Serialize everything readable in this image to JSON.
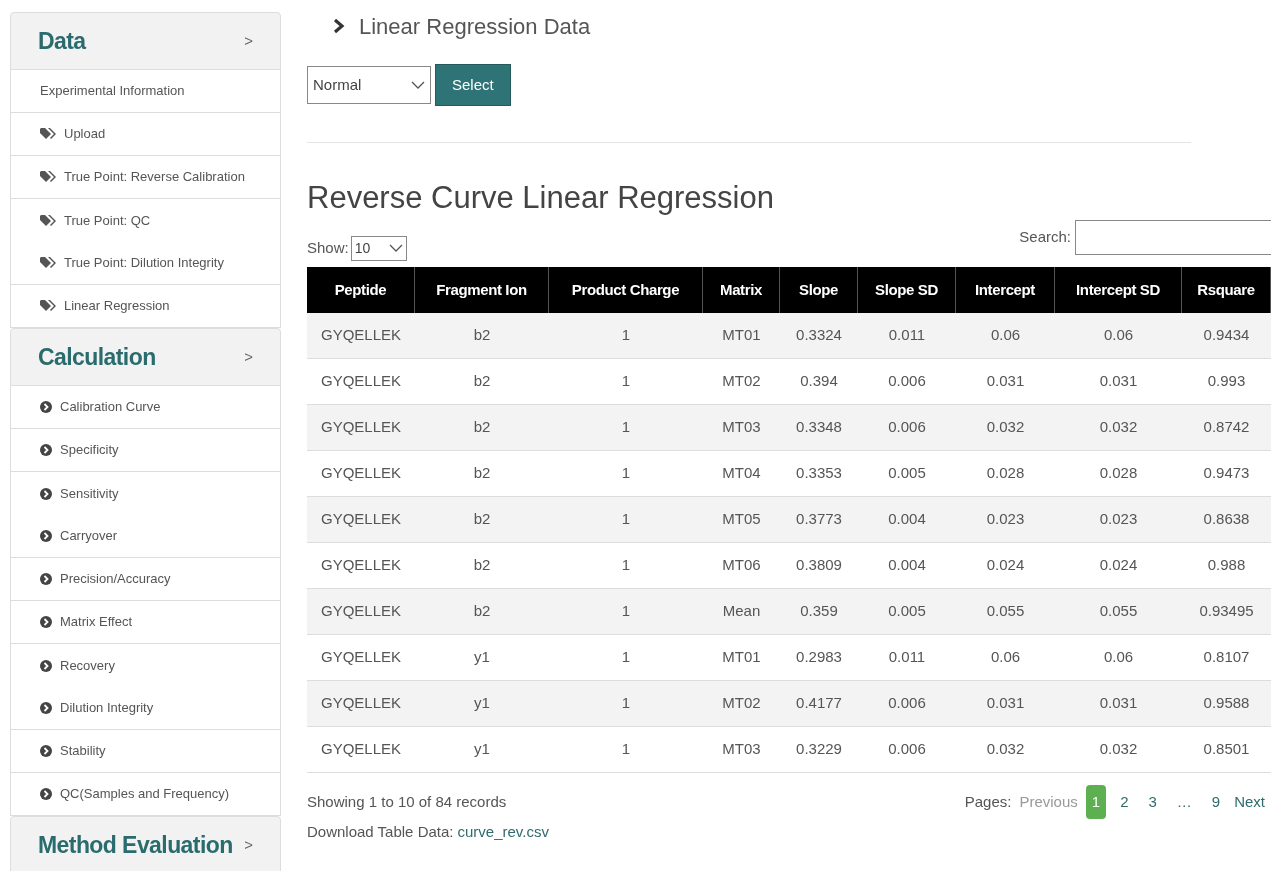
{
  "sidebar": {
    "sections": [
      {
        "title": "Data",
        "chevron": ">",
        "items": [
          {
            "label": "Experimental Information",
            "kind": "plain",
            "divider": true
          },
          {
            "label": "Upload",
            "kind": "tag",
            "divider": true
          },
          {
            "label": "True Point: Reverse Calibration",
            "kind": "tag",
            "divider": true
          },
          {
            "label": "True Point: QC",
            "kind": "tag",
            "divider": false
          },
          {
            "label": "True Point: Dilution Integrity",
            "kind": "tag",
            "divider": true
          },
          {
            "label": "Linear Regression",
            "kind": "tag",
            "divider": true
          }
        ]
      },
      {
        "title": "Calculation",
        "chevron": ">",
        "items": [
          {
            "label": "Calibration Curve",
            "kind": "circle",
            "divider": true
          },
          {
            "label": "Specificity",
            "kind": "circle",
            "divider": true
          },
          {
            "label": "Sensitivity",
            "kind": "circle",
            "divider": false
          },
          {
            "label": "Carryover",
            "kind": "circle",
            "divider": true
          },
          {
            "label": "Precision/Accuracy",
            "kind": "circle",
            "divider": true
          },
          {
            "label": "Matrix Effect",
            "kind": "circle",
            "divider": true
          },
          {
            "label": "Recovery",
            "kind": "circle",
            "divider": false
          },
          {
            "label": "Dilution Integrity",
            "kind": "circle",
            "divider": true
          },
          {
            "label": "Stability",
            "kind": "circle",
            "divider": true
          },
          {
            "label": "QC(Samples and Frequency)",
            "kind": "circle",
            "divider": true
          }
        ]
      },
      {
        "title": "Method Evaluation",
        "chevron": ">"
      }
    ]
  },
  "breadcrumb": {
    "title": "Linear Regression Data"
  },
  "mode_select": {
    "value": "Normal",
    "button": "Select"
  },
  "table_title": "Reverse Curve Linear Regression",
  "show": {
    "label": "Show:",
    "value": "10"
  },
  "search": {
    "label": "Search:"
  },
  "table": {
    "columns": [
      "Peptide",
      "Fragment Ion",
      "Product Charge",
      "Matrix",
      "Slope",
      "Slope SD",
      "Intercept",
      "Intercept SD",
      "Rsquare"
    ],
    "rows": [
      [
        "GYQELLEK",
        "b2",
        "1",
        "MT01",
        "0.3324",
        "0.011",
        "0.06",
        "0.06",
        "0.9434"
      ],
      [
        "GYQELLEK",
        "b2",
        "1",
        "MT02",
        "0.394",
        "0.006",
        "0.031",
        "0.031",
        "0.993"
      ],
      [
        "GYQELLEK",
        "b2",
        "1",
        "MT03",
        "0.3348",
        "0.006",
        "0.032",
        "0.032",
        "0.8742"
      ],
      [
        "GYQELLEK",
        "b2",
        "1",
        "MT04",
        "0.3353",
        "0.005",
        "0.028",
        "0.028",
        "0.9473"
      ],
      [
        "GYQELLEK",
        "b2",
        "1",
        "MT05",
        "0.3773",
        "0.004",
        "0.023",
        "0.023",
        "0.8638"
      ],
      [
        "GYQELLEK",
        "b2",
        "1",
        "MT06",
        "0.3809",
        "0.004",
        "0.024",
        "0.024",
        "0.988"
      ],
      [
        "GYQELLEK",
        "b2",
        "1",
        "Mean",
        "0.359",
        "0.005",
        "0.055",
        "0.055",
        "0.93495"
      ],
      [
        "GYQELLEK",
        "y1",
        "1",
        "MT01",
        "0.2983",
        "0.011",
        "0.06",
        "0.06",
        "0.8107"
      ],
      [
        "GYQELLEK",
        "y1",
        "1",
        "MT02",
        "0.4177",
        "0.006",
        "0.031",
        "0.031",
        "0.9588"
      ],
      [
        "GYQELLEK",
        "y1",
        "1",
        "MT03",
        "0.3229",
        "0.006",
        "0.032",
        "0.032",
        "0.8501"
      ]
    ]
  },
  "records": "Showing 1 to 10 of 84 records",
  "pagination": {
    "label": "Pages:",
    "previous": {
      "label": "Previous",
      "disabled": true
    },
    "pages": [
      {
        "label": "1",
        "selected": true
      },
      {
        "label": "2",
        "selected": false
      },
      {
        "label": "3",
        "selected": false
      },
      {
        "label": "…",
        "selected": false
      },
      {
        "label": "9",
        "selected": false
      }
    ],
    "next": {
      "label": "Next",
      "disabled": false
    }
  },
  "download": {
    "label": "Download Table Data:",
    "link": "curve_rev.csv"
  }
}
